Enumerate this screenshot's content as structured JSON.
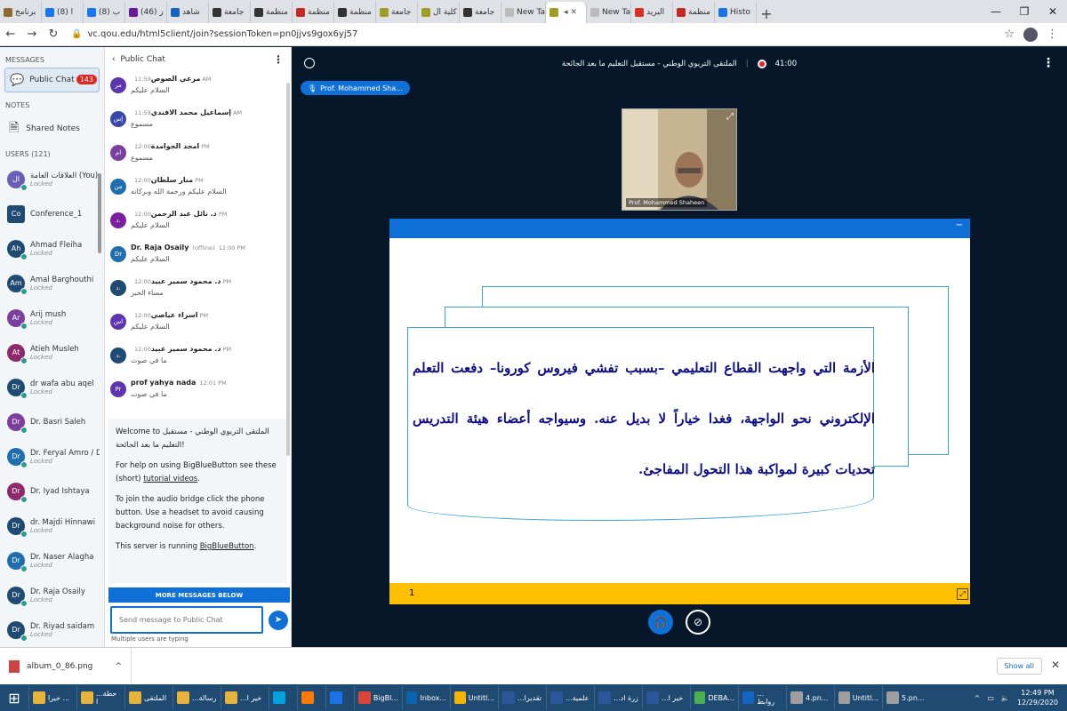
{
  "browser": {
    "tabs": [
      {
        "label": "برنامج",
        "color": "#8c6b2f"
      },
      {
        "label": "(8) ا",
        "color": "#1877f2"
      },
      {
        "label": "(8) ب",
        "color": "#1877f2"
      },
      {
        "label": "(46) ر",
        "color": "#6a1b9a"
      },
      {
        "label": "شاهد",
        "color": "#1565c0"
      },
      {
        "label": "جامعة",
        "color": "#333"
      },
      {
        "label": "منظمة",
        "color": "#333"
      },
      {
        "label": "منظمة",
        "color": "#c62828"
      },
      {
        "label": "منظمة",
        "color": "#333"
      },
      {
        "label": "جامعة",
        "color": "#9e9d24"
      },
      {
        "label": "كلية ال",
        "color": "#9e9d24"
      },
      {
        "label": "جامعة",
        "color": "#333"
      },
      {
        "label": "New Tab",
        "color": "#bbb"
      },
      {
        "label": "",
        "color": "#9e9d24",
        "active": true
      },
      {
        "label": "New Tab",
        "color": "#bbb"
      },
      {
        "label": "البريد",
        "color": "#d93025"
      },
      {
        "label": "منظمة",
        "color": "#c62828"
      },
      {
        "label": "Histo",
        "color": "#1a73e8"
      }
    ],
    "url": "vc.qou.edu/html5client/join?sessionToken=pn0jjvs9gox6yj57"
  },
  "sidebar": {
    "messages_header": "MESSAGES",
    "public_chat_label": "Public Chat",
    "public_chat_badge": "143",
    "notes_header": "NOTES",
    "shared_notes_label": "Shared Notes",
    "users_header": "USERS (121)",
    "users": [
      {
        "initials": "ال",
        "name": "العلاقات العامة (You)",
        "status": "Locked",
        "color": "#6b5fb5"
      },
      {
        "initials": "Co",
        "name": "Conference_1",
        "status": "",
        "color": "#1f4a72",
        "square": true
      },
      {
        "initials": "Ah",
        "name": "Ahmad Fleiha",
        "status": "Locked",
        "color": "#1f4a72"
      },
      {
        "initials": "Am",
        "name": "Amal Barghouthi",
        "status": "Locked",
        "color": "#1f4a72"
      },
      {
        "initials": "Ar",
        "name": "Arij mush",
        "status": "Locked",
        "color": "#7b3fa0"
      },
      {
        "initials": "At",
        "name": "Atieh Musleh",
        "status": "Locked",
        "color": "#8e2a6b"
      },
      {
        "initials": "Dr",
        "name": "dr wafa abu aqel",
        "status": "Locked",
        "color": "#1f4a72"
      },
      {
        "initials": "Dr",
        "name": "Dr. Basri Saleh",
        "status": "",
        "color": "#7b3fa0"
      },
      {
        "initials": "Dr",
        "name": "Dr. Feryal Amro / Du...",
        "status": "Locked",
        "color": "#1f6fb0"
      },
      {
        "initials": "Dr",
        "name": "Dr. Iyad Ishtaya",
        "status": "",
        "color": "#8e2a6b"
      },
      {
        "initials": "Dr",
        "name": "dr. Majdi Hinnawi",
        "status": "Locked",
        "color": "#1f4a72"
      },
      {
        "initials": "Dr",
        "name": "Dr. Naser Alagha",
        "status": "Locked",
        "color": "#1f6fb0"
      },
      {
        "initials": "Dr",
        "name": "Dr. Raja Osaily",
        "status": "Locked",
        "color": "#1f4a72"
      },
      {
        "initials": "Dr",
        "name": "Dr. Riyad saidam",
        "status": "Locked",
        "color": "#1f4a72"
      }
    ]
  },
  "chat": {
    "title": "Public Chat",
    "messages": [
      {
        "initials": "مر",
        "name": "مرعي الصوص",
        "time": "11:59 AM",
        "text": "السلام عليكم",
        "color": "#5e35b1"
      },
      {
        "initials": "إس",
        "name": "إسماعيل محمد الافندي",
        "time": "11:59 AM",
        "text": "مسموع",
        "color": "#3949ab"
      },
      {
        "initials": "ام",
        "name": "امجد الجوامدة",
        "time": "12:00 PM",
        "text": "مسموع",
        "color": "#7b3fa0"
      },
      {
        "initials": "من",
        "name": "منار سلطان",
        "time": "12:00 PM",
        "text": "السلام عليكم ورحمة الله وبركاته",
        "color": "#1f6fb0"
      },
      {
        "initials": "د.",
        "name": "د. نائل عبد الرحمن",
        "time": "12:00 PM",
        "text": "السلام عليكم",
        "color": "#7b1fa2"
      },
      {
        "initials": "Dr",
        "name": "Dr. Raja Osaily",
        "offline": "(offline)",
        "time": "12:00 PM",
        "text": "السلام عليكم",
        "color": "#1f6fb0"
      },
      {
        "initials": "د.",
        "name": "د. محمود سمير عبيد",
        "time": "12:00 PM",
        "text": "مساء الخير",
        "color": "#1f4a72"
      },
      {
        "initials": "اس",
        "name": "اسراء عياصي",
        "time": "12:00 PM",
        "text": "السلام عليكم",
        "color": "#5e35b1"
      },
      {
        "initials": "د.",
        "name": "د. محمود سمير عبيد",
        "time": "12:00 PM",
        "text": "ما في صوت",
        "color": "#1f4a72"
      },
      {
        "initials": "Pr",
        "name": "prof yahya nada",
        "time": "12:01 PM",
        "text": "ما في صوت",
        "color": "#5e35b1"
      }
    ],
    "welcome": {
      "line1": "Welcome to الملتقى التربوي الوطني - مستقبل التعليم ما بعد الجائحة!",
      "line2a": "For help on using BigBlueButton see these (short) ",
      "line2link": "tutorial videos",
      "line2b": ".",
      "line3": "To join the audio bridge click the phone button. Use a headset to avoid causing background noise for others.",
      "line4a": "This server is running ",
      "line4link": "BigBlueButton",
      "line4b": "."
    },
    "more_messages": "MORE MESSAGES BELOW",
    "input_placeholder": "Send message to Public Chat",
    "typing": "Multiple users are typing"
  },
  "main": {
    "meeting_title": "الملتقى التربوي الوطني - مستقبل التعليم ما بعد الجائحة",
    "recording_time": "41:00",
    "presenter": "Prof. Mohammed Sha...",
    "webcam_name": "Prof. Mohammed Shaheen",
    "slide_text": "الأزمة التي واجهت القطاع التعليمي –بسبب تفشي فيروس كورونا– دفعت التعلم الإلكتروني نحو الواجهة، فغدا خياراً لا بديل عنه. وسيواجه أعضاء هيئة التدريس تحديات كبيرة لمواكبة هذا التحول المفاجئ.",
    "page_number": "1"
  },
  "download": {
    "file": "album_0_86.png",
    "show_all": "Show all"
  },
  "taskbar": {
    "items": [
      {
        "label": "خيرا ...",
        "color": "#e8b33a"
      },
      {
        "label": "...حطة ا",
        "color": "#e8b33a"
      },
      {
        "label": "الملتقى",
        "color": "#e8b33a"
      },
      {
        "label": "...رسالة",
        "color": "#e8b33a"
      },
      {
        "label": "...خير ا",
        "color": "#e8b33a"
      },
      {
        "label": "",
        "color": "#00a1e0"
      },
      {
        "label": "",
        "color": "#ff7a00"
      },
      {
        "label": "",
        "color": "#1a73e8"
      },
      {
        "label": "BigBl...",
        "color": "#db4437"
      },
      {
        "label": "Inbox...",
        "color": "#0a64ad"
      },
      {
        "label": "Untitl...",
        "color": "#f4b400"
      },
      {
        "label": "...تقديرا",
        "color": "#2b579a"
      },
      {
        "label": "...علمية",
        "color": "#2b579a"
      },
      {
        "label": "...زرة اد",
        "color": "#2b579a"
      },
      {
        "label": "...خير ا",
        "color": "#2b579a"
      },
      {
        "label": "DEBA...",
        "color": "#4caf50"
      },
      {
        "label": "... روابط",
        "color": "#1565c0"
      },
      {
        "label": "4.pn...",
        "color": "#9e9e9e"
      },
      {
        "label": "Untitl...",
        "color": "#9e9e9e"
      },
      {
        "label": "5.pn...",
        "color": "#9e9e9e"
      }
    ],
    "time": "12:49 PM",
    "date": "12/29/2020"
  }
}
